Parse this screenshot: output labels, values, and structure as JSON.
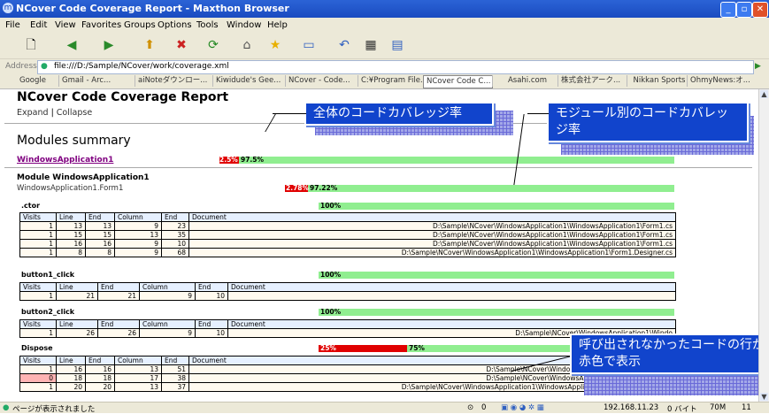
{
  "window": {
    "title": "NCover Code Coverage Report - Maxthon Browser",
    "colors": {
      "titlebar": "#1a4bc0",
      "close": "#e0512a"
    }
  },
  "menu": [
    "File",
    "Edit",
    "View",
    "Favorites",
    "Groups",
    "Options",
    "Tools",
    "Window",
    "Help"
  ],
  "address": {
    "label": "Address",
    "value": "file:///D:/Sample/NCover/work/coverage.xml"
  },
  "tabs": [
    "Google",
    "Gmail - Arc...",
    "aiNoteダウンロー...",
    "Kiwidude's Gee...",
    "NCover - Code...",
    "C:¥Program File...",
    "NCover Code C...",
    "Asahi.com",
    "株式会社アーク...",
    "Nikkan Sports",
    "OhmyNews:オ..."
  ],
  "report": {
    "title": "NCover Code Coverage Report",
    "expand": "Expand",
    "collapse": "Collapse",
    "modules_summary": "Modules summary",
    "module_link": "WindowsApplication1",
    "summary_bar": {
      "uncovered_label": "2.5%",
      "covered_label": "97.5%",
      "uncovered": 2.5,
      "covered": 97.5
    },
    "module_heading": "Module WindowsApplication1",
    "class_name": "WindowsApplication1.Form1",
    "class_bar": {
      "uncovered_label": "2.78%",
      "covered_label": "97.22%",
      "uncovered": 2.78,
      "covered": 97.22
    },
    "columns": [
      "Visits",
      "Line",
      "End",
      "Column",
      "End",
      "Document"
    ],
    "methods": [
      {
        "name": ".ctor",
        "pct_label": "100%",
        "covered": 100,
        "rows": [
          [
            "1",
            "13",
            "13",
            "9",
            "23",
            "D:\\Sample\\NCover\\WindowsApplication1\\WindowsApplication1\\Form1.cs"
          ],
          [
            "1",
            "15",
            "15",
            "13",
            "35",
            "D:\\Sample\\NCover\\WindowsApplication1\\WindowsApplication1\\Form1.cs"
          ],
          [
            "1",
            "16",
            "16",
            "9",
            "10",
            "D:\\Sample\\NCover\\WindowsApplication1\\WindowsApplication1\\Form1.cs"
          ],
          [
            "1",
            "8",
            "8",
            "9",
            "68",
            "D:\\Sample\\NCover\\WindowsApplication1\\WindowsApplication1\\Form1.Designer.cs"
          ]
        ]
      },
      {
        "name": "button1_click",
        "pct_label": "100%",
        "covered": 100,
        "rows": [
          [
            "1",
            "21",
            "21",
            "9",
            "10",
            ""
          ]
        ]
      },
      {
        "name": "button2_click",
        "pct_label": "100%",
        "covered": 100,
        "rows": [
          [
            "1",
            "26",
            "26",
            "9",
            "10",
            "D:\\Sample\\NCover\\WindowsApplication1\\Windo"
          ]
        ]
      },
      {
        "name": "Dispose",
        "uncovered_label": "25%",
        "covered_label": "75%",
        "covered": 75,
        "rows": [
          [
            "1",
            "16",
            "16",
            "13",
            "51",
            "D:\\Sample\\NCover\\WindowsApplication1\\WindowsApplic"
          ],
          [
            "0",
            "18",
            "18",
            "17",
            "38",
            "D:\\Sample\\NCover\\WindowsApplication1\\WindowsApplic"
          ],
          [
            "1",
            "20",
            "20",
            "13",
            "37",
            "D:\\Sample\\NCover\\WindowsApplication1\\WindowsApplication1\\Form1.Designer.cs"
          ]
        ]
      }
    ]
  },
  "callouts": {
    "overall": "全体のコードカバレッジ率",
    "module": "モジュール別のコードカバレッジ率",
    "uncalled": "呼び出されなかったコードの行が赤色で表示"
  },
  "status": {
    "text": "ページが表示されました",
    "counter": "0",
    "ip": "192.168.11.23",
    "bytes": "0 バイト",
    "mem": "70M",
    "extra": "11"
  }
}
